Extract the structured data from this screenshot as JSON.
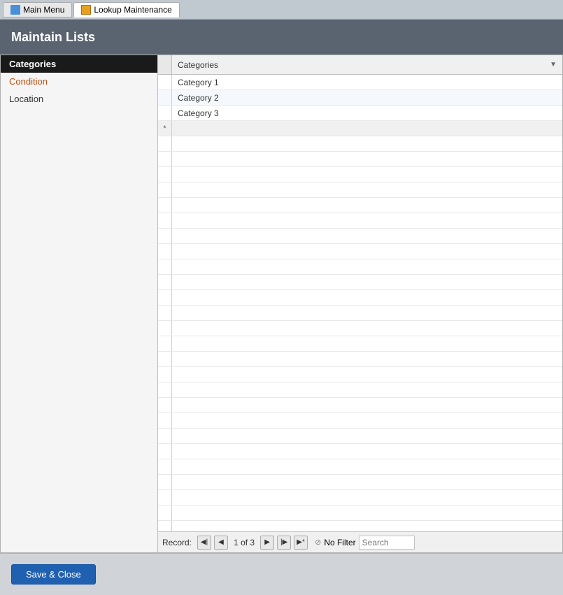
{
  "tabs": [
    {
      "id": "main-menu",
      "label": "Main Menu",
      "active": false
    },
    {
      "id": "lookup-maintenance",
      "label": "Lookup Maintenance",
      "active": true
    }
  ],
  "page_title": "Maintain Lists",
  "sidebar": {
    "items": [
      {
        "id": "categories",
        "label": "Categories",
        "selected": true
      },
      {
        "id": "condition",
        "label": "Condition",
        "selected": false
      },
      {
        "id": "location",
        "label": "Location",
        "selected": false
      }
    ]
  },
  "table": {
    "column_header": "Categories",
    "rows": [
      {
        "value": "Category 1"
      },
      {
        "value": "Category 2"
      },
      {
        "value": "Category 3"
      }
    ]
  },
  "navigation": {
    "record_label": "Record:",
    "current_record": "1",
    "total_records": "3",
    "record_of": "of",
    "filter_label": "No Filter",
    "search_placeholder": "Search"
  },
  "footer": {
    "save_close_label": "Save & Close"
  },
  "icons": {
    "main_menu_icon": "▦",
    "lookup_icon": "▤",
    "first_record": "◀|",
    "prev_record": "◀",
    "next_record": "▶",
    "last_record": "|▶",
    "new_record": "▶*",
    "dropdown_arrow": "▼",
    "filter_icon": "⊘"
  }
}
